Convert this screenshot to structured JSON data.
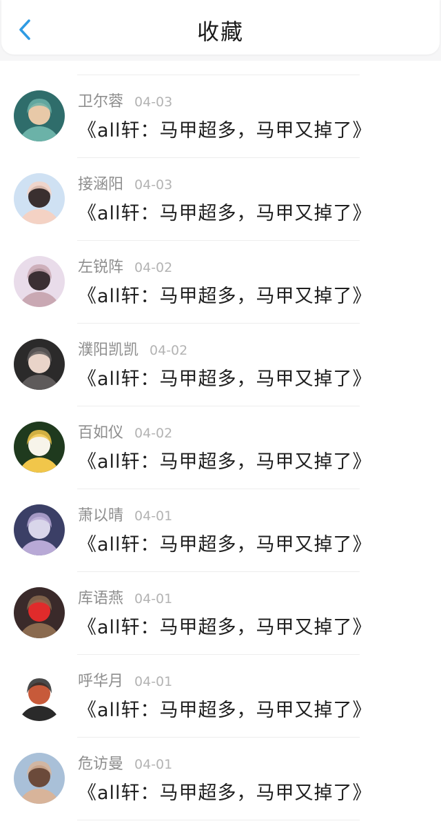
{
  "header": {
    "title": "收藏",
    "back_icon": "chevron-left-icon",
    "accent_color": "#2f9be3"
  },
  "items": [
    {
      "name": "卫尔蓉",
      "date": "04-03",
      "title": "《all轩：马甲超多，马甲又掉了》",
      "avatar_colors": [
        "#2f6d6b",
        "#e8c9a8",
        "#6bb2a8"
      ]
    },
    {
      "name": "接涵阳",
      "date": "04-03",
      "title": "《all轩：马甲超多，马甲又掉了》",
      "avatar_colors": [
        "#cfe1f3",
        "#3a2f2f",
        "#f4d2c4"
      ]
    },
    {
      "name": "左锐阵",
      "date": "04-02",
      "title": "《all轩：马甲超多，马甲又掉了》",
      "avatar_colors": [
        "#e9dcea",
        "#3b2f33",
        "#c9a8b3"
      ]
    },
    {
      "name": "濮阳凯凯",
      "date": "04-02",
      "title": "《all轩：马甲超多，马甲又掉了》",
      "avatar_colors": [
        "#2b2a2a",
        "#e9d4c9",
        "#5e5a5a"
      ]
    },
    {
      "name": "百如仪",
      "date": "04-02",
      "title": "《all轩：马甲超多，马甲又掉了》",
      "avatar_colors": [
        "#1f3a1e",
        "#f7f4ea",
        "#f1c64a"
      ]
    },
    {
      "name": "萧以晴",
      "date": "04-01",
      "title": "《all轩：马甲超多，马甲又掉了》",
      "avatar_colors": [
        "#3b3f66",
        "#d9d6ea",
        "#b8a9d6"
      ]
    },
    {
      "name": "库语燕",
      "date": "04-01",
      "title": "《all轩：马甲超多，马甲又掉了》",
      "avatar_colors": [
        "#3a2a2a",
        "#e02b2b",
        "#8a6a4f"
      ]
    },
    {
      "name": "呼华月",
      "date": "04-01",
      "title": "《all轩：马甲超多，马甲又掉了》",
      "avatar_colors": [
        "#ffffff",
        "#c75a3a",
        "#2a2a2a"
      ]
    },
    {
      "name": "危访曼",
      "date": "04-01",
      "title": "《all轩：马甲超多，马甲又掉了》",
      "avatar_colors": [
        "#a9c0d8",
        "#6b4a3a",
        "#d8b49a"
      ]
    }
  ]
}
